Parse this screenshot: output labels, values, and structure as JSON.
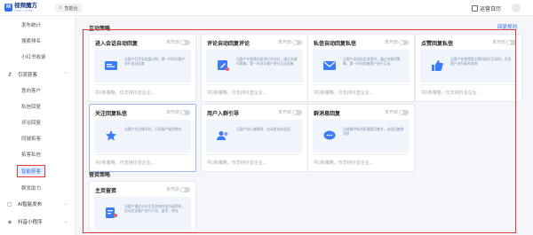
{
  "header": {
    "logo_mark": "M",
    "app_name": "视频魔方",
    "app_sub": "MAGIC CUBE",
    "tab_label": "智能台",
    "calendar_label": "运营日历"
  },
  "sidebar": {
    "items": [
      {
        "label": "发布统计",
        "type": "sub"
      },
      {
        "label": "搜索排名",
        "type": "sub"
      },
      {
        "label": "小红书收录",
        "type": "sub"
      },
      {
        "label": "引流获客",
        "type": "group",
        "icon": "⇵"
      },
      {
        "label": "意向客户",
        "type": "sub"
      },
      {
        "label": "私信回复",
        "type": "sub"
      },
      {
        "label": "评论回复",
        "type": "sub"
      },
      {
        "label": "同城拓客",
        "type": "sub"
      },
      {
        "label": "拓客私信",
        "type": "sub"
      },
      {
        "label": "智能获客",
        "type": "sub",
        "active": true
      },
      {
        "label": "群发助力",
        "type": "sub"
      },
      {
        "label": "AI智能发布",
        "type": "group",
        "icon": "▢"
      },
      {
        "label": "抖音小程序",
        "type": "group",
        "icon": "◈"
      }
    ]
  },
  "main": {
    "section1_title": "互动策略",
    "rule_link": "回复规则",
    "section2_title": "营资策略",
    "status_off": "未开启",
    "footer_text": "共0条策略，仅支持抖音企业...",
    "cards": [
      {
        "title": "进入会话自动回复",
        "desc": "当客户打开私信窗口时，第一时间对客户进行自动回复",
        "icon": "chat-window-icon"
      },
      {
        "title": "评论自动回复评论",
        "desc": "当客户在视频内容进行评论时，通过关键词策略，第一时间与客户进行互动回复",
        "icon": "comment-edit-icon"
      },
      {
        "title": "私信自动回复私信",
        "desc": "当客户发送私信消息时，通过关键词策略，第一时间回复客户进行互动",
        "icon": "mail-icon"
      },
      {
        "title": "点赞回复私信",
        "desc": "当客户在视频里点赞时进行互动时，引导客户进行联系咨询",
        "icon": "thumbs-up-icon"
      },
      {
        "title": "关注回复私信",
        "desc": "当客户关注账号时，引导客户留资转化",
        "icon": "star-follow-icon"
      },
      {
        "title": "用户入群引导",
        "desc": "当客户进入群聊时，自动发送欢迎语",
        "icon": "users-icon"
      },
      {
        "title": "群消息回复",
        "desc": "当群聊中有消息需要回复时，自动回复群消息",
        "icon": "group-chat-icon"
      },
      {
        "title": "主页留资",
        "desc": "当客户通过访问主页咨询并进行留资时，自动发送客户进行引导、留资、转化",
        "icon": "homepage-icon"
      }
    ]
  },
  "colors": {
    "accent": "#2f6bff",
    "highlight_border": "#e53935",
    "card_body_bg": "#f0f4fb"
  }
}
